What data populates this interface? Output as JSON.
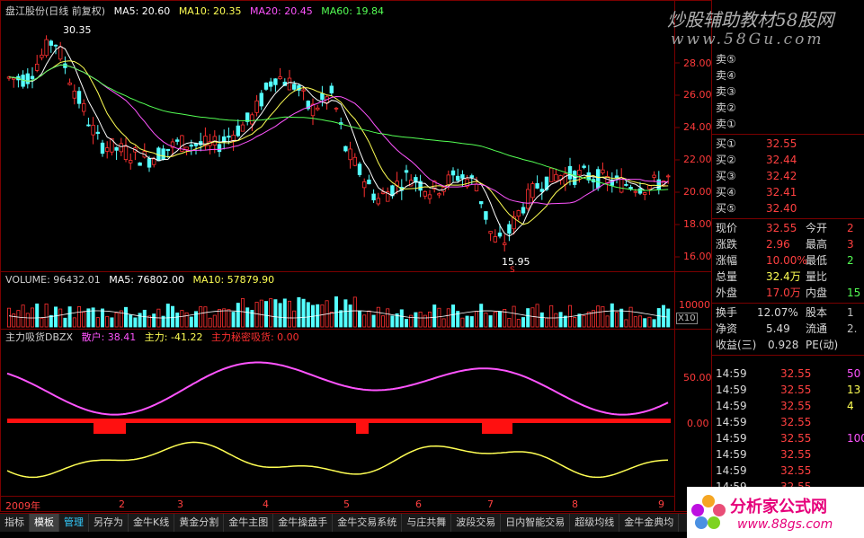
{
  "header": {
    "stock": "盘江股份(日线 前复权)",
    "ma5": "MA5: 20.60",
    "ma10": "MA10: 20.35",
    "ma20": "MA20: 20.45",
    "ma60": "MA60: 19.84",
    "high_mark": "30.35",
    "low_mark": "15.95",
    "low_badge": "S"
  },
  "colors": {
    "up": "#ff3030",
    "down": "#54ffff",
    "ma5": "#ffffff",
    "ma10": "#ffff54",
    "ma20": "#ff54ff",
    "ma60": "#54ff54",
    "grid": "#7a0000"
  },
  "price_axis": [
    "28.00",
    "26.00",
    "24.00",
    "22.00",
    "20.00",
    "18.00",
    "16.00"
  ],
  "volume": {
    "label": "VOLUME: 96432.01",
    "ma5": "MA5: 76802.00",
    "ma10": "MA10: 57879.90",
    "axis": "10000",
    "unit": "X10"
  },
  "indicator": {
    "name": "主力吸货DBZX",
    "retail": "散户: 38.41",
    "main": "主力: -41.22",
    "secret": "主力秘密吸货: 0.00",
    "axis": [
      "50.00",
      "0.00"
    ]
  },
  "months": [
    "2009年",
    "2",
    "3",
    "4",
    "5",
    "6",
    "7",
    "8",
    "9"
  ],
  "tabs": [
    "指标",
    "模板",
    "管理",
    "另存为",
    "金牛K线",
    "黄金分割",
    "金牛主图",
    "金牛操盘手",
    "金牛交易系统",
    "与庄共舞",
    "波段交易",
    "日内智能交易",
    "超级均线",
    "金牛金典均"
  ],
  "order_book": {
    "sell": [
      "卖⑤",
      "卖④",
      "卖③",
      "卖②",
      "卖①"
    ],
    "buy": [
      {
        "label": "买①",
        "price": "32.55"
      },
      {
        "label": "买②",
        "price": "32.44"
      },
      {
        "label": "买③",
        "price": "32.42"
      },
      {
        "label": "买④",
        "price": "32.41"
      },
      {
        "label": "买⑤",
        "price": "32.40"
      }
    ]
  },
  "quote": [
    {
      "l1": "现价",
      "v1": "32.55",
      "l2": "今开",
      "v2": "2"
    },
    {
      "l1": "涨跌",
      "v1": "2.96",
      "l2": "最高",
      "v2": "3"
    },
    {
      "l1": "涨幅",
      "v1": "10.00%",
      "l2": "最低",
      "v2": "2"
    },
    {
      "l1": "总量",
      "v1": "32.4万",
      "l2": "量比",
      "v2": ""
    },
    {
      "l1": "外盘",
      "v1": "17.0万",
      "l2": "内盘",
      "v2": "15"
    }
  ],
  "stats": [
    {
      "l1": "换手",
      "v1": "12.07%",
      "l2": "股本",
      "v2": "1"
    },
    {
      "l1": "净资",
      "v1": "5.49",
      "l2": "流通",
      "v2": "2."
    },
    {
      "l1": "收益(三)",
      "v1": "0.928",
      "l2": "PE(动)",
      "v2": ""
    }
  ],
  "ticks": [
    {
      "time": "14:59",
      "price": "32.55",
      "vol": "50"
    },
    {
      "time": "14:59",
      "price": "32.55",
      "vol": "13"
    },
    {
      "time": "14:59",
      "price": "32.55",
      "vol": "4"
    },
    {
      "time": "14:59",
      "price": "32.55",
      "vol": ""
    },
    {
      "time": "14:59",
      "price": "32.55",
      "vol": "100"
    },
    {
      "time": "14:59",
      "price": "32.55",
      "vol": ""
    },
    {
      "time": "14:59",
      "price": "32.55",
      "vol": ""
    },
    {
      "time": "14:59",
      "price": "32.55",
      "vol": ""
    }
  ],
  "watermark": {
    "top_line1": "炒股辅助教材58股网",
    "top_line2": "www.58Gu.com",
    "bottom_line1": "分析家公式网",
    "bottom_line2": "www.88gs.com"
  }
}
